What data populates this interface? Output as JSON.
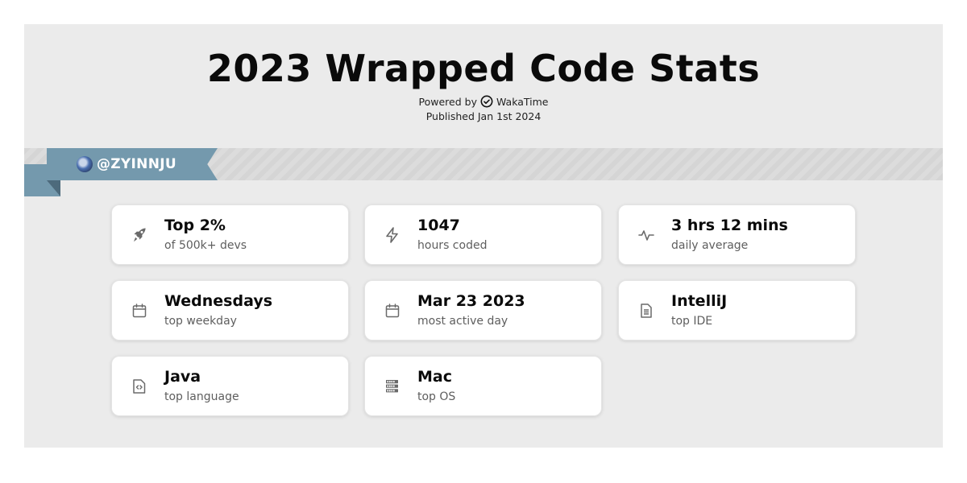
{
  "header": {
    "title": "2023 Wrapped Code Stats",
    "powered_by_prefix": "Powered by",
    "powered_by_brand": "WakaTime",
    "published": "Published Jan 1st 2024"
  },
  "user": {
    "handle": "@ZYINNJU",
    "ribbon_color": "#7499ad"
  },
  "stats": [
    {
      "icon": "rocket-icon",
      "value": "Top 2%",
      "label": "of 500k+ devs"
    },
    {
      "icon": "lightning-bolt-icon",
      "value": "1047",
      "label": "hours coded"
    },
    {
      "icon": "activity-pulse-icon",
      "value": "3 hrs 12 mins",
      "label": "daily average"
    },
    {
      "icon": "calendar-icon",
      "value": "Wednesdays",
      "label": "top weekday"
    },
    {
      "icon": "calendar-icon",
      "value": "Mar 23 2023",
      "label": "most active day"
    },
    {
      "icon": "document-icon",
      "value": "IntelliJ",
      "label": "top IDE"
    },
    {
      "icon": "code-file-icon",
      "value": "Java",
      "label": "top language"
    },
    {
      "icon": "server-icon",
      "value": "Mac",
      "label": "top OS"
    }
  ]
}
